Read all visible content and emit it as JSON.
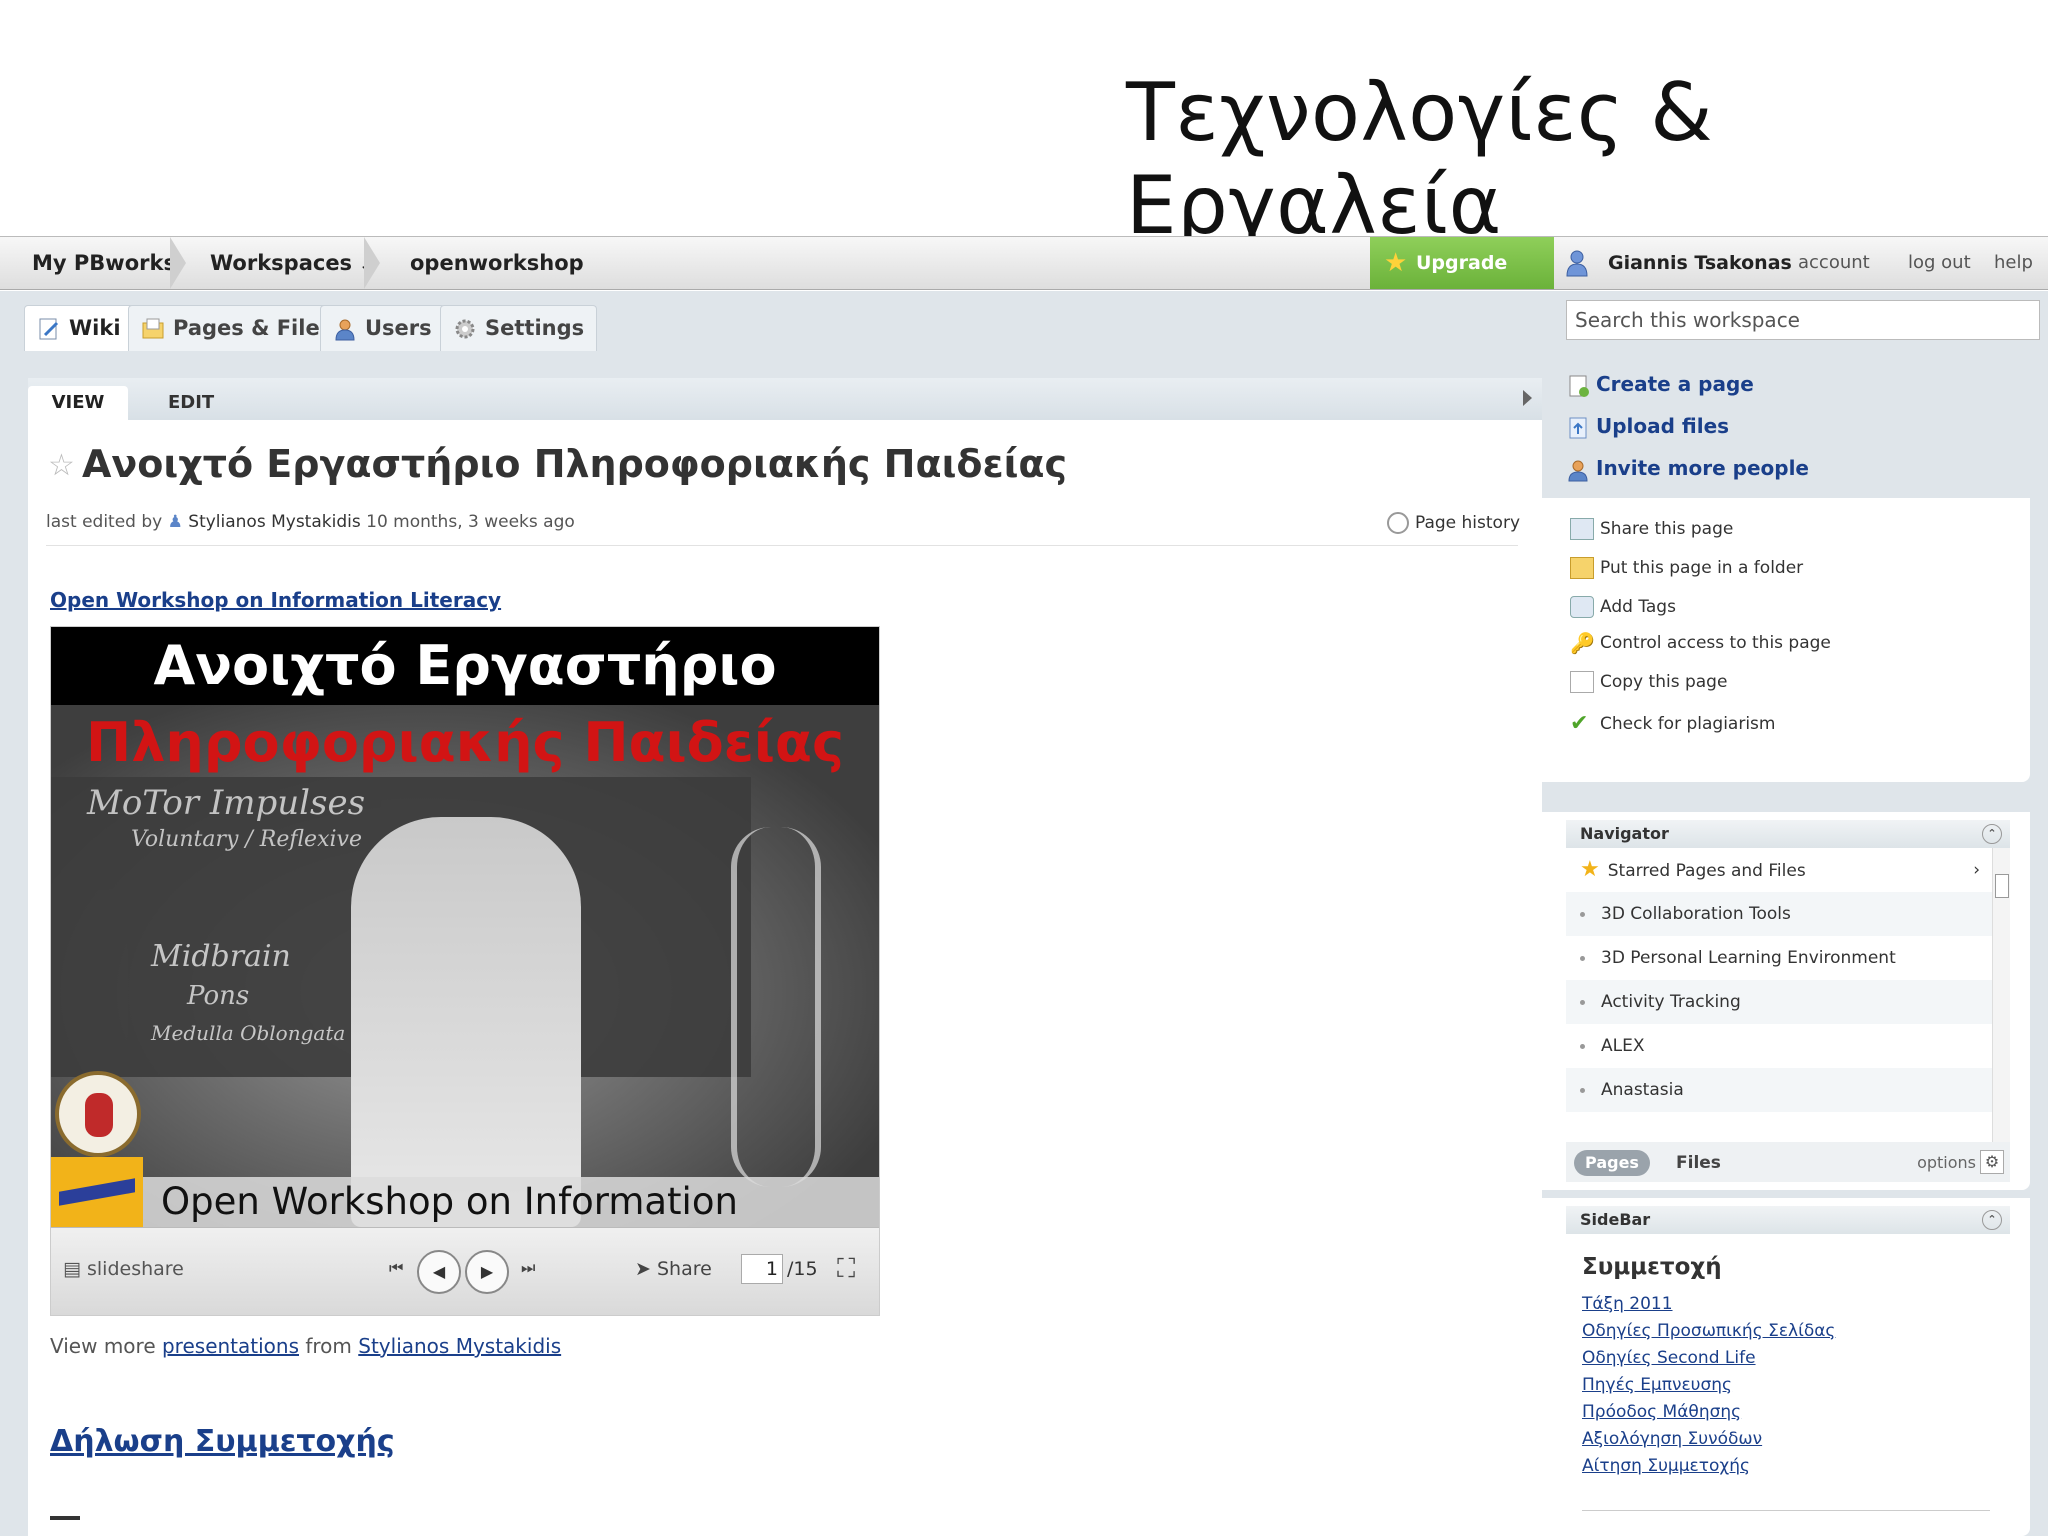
{
  "slide_title": "Τεχνολογίες & Εργαλεία",
  "topbar": {
    "crumbs": [
      "My PBworks",
      "Workspaces",
      "openworkshop"
    ],
    "upgrade": "Upgrade Now!",
    "user": "Giannis Tsakonas",
    "account": "account",
    "logout": "log out",
    "help": "help"
  },
  "nav": {
    "wiki": "Wiki",
    "pages_files": "Pages & Files",
    "users": "Users",
    "settings": "Settings"
  },
  "search": {
    "placeholder": "Search this workspace"
  },
  "tabs": {
    "view": "VIEW",
    "edit": "EDIT"
  },
  "page": {
    "title": "Ανοιχτό Εργαστήριο Πληροφοριακής Παιδείας",
    "last_edited_prefix": "last edited by",
    "editor": "Stylianos Mystakidis",
    "edited_when": "10 months, 3 weeks ago",
    "history": "Page history",
    "workshop_link": "Open Workshop on Information Literacy",
    "view_more_prefix": "View more",
    "view_more_link": "presentations",
    "view_more_from": "from",
    "view_more_author": "Stylianos Mystakidis",
    "dilosi": "Δήλωση Συμμετοχής"
  },
  "embed": {
    "slide_line1": "Ανοιχτό Εργαστήριο",
    "slide_line2": "Πληροφοριακής Παιδείας",
    "slide_footer": "Open Workshop on Information Literacy",
    "board_1": "MoTor  Impulses",
    "board_2": "Voluntary / Reflexive",
    "board_3": "Midbrain",
    "board_4": "Pons",
    "board_5": "Medulla Oblongata",
    "slideshare": "slideshare",
    "share": "Share",
    "current_page": "1",
    "total_pages": "/15"
  },
  "actions": {
    "create": "Create a page",
    "upload": "Upload files",
    "invite": "Invite more people"
  },
  "page_actions": [
    "Share this page",
    "Put this page in a folder",
    "Add Tags",
    "Control access to this page",
    "Copy this page",
    "Check for plagiarism"
  ],
  "navigator": {
    "title": "Navigator",
    "starred": "Starred Pages and Files",
    "items": [
      "3D Collaboration Tools",
      "3D Personal Learning Environment",
      "Activity Tracking",
      "ALEX",
      "Anastasia"
    ],
    "pages": "Pages",
    "files": "Files",
    "options": "options"
  },
  "sidebar": {
    "title": "SideBar",
    "heading": "Συμμετοχή",
    "links": [
      "Τάξη 2011",
      "Οδηγίες Προσωπικής Σελίδας",
      "Οδηγίες Second Life",
      "Πηγές Εμπνευσης",
      "Πρόοδος Μάθησης",
      "Αξιολόγηση Συνόδων",
      "Αίτηση Συμμετοχής"
    ]
  },
  "colors": {
    "link": "#1a3f8a",
    "upgrade": "#7cc04a",
    "panel_bg": "#dfe5ea"
  }
}
